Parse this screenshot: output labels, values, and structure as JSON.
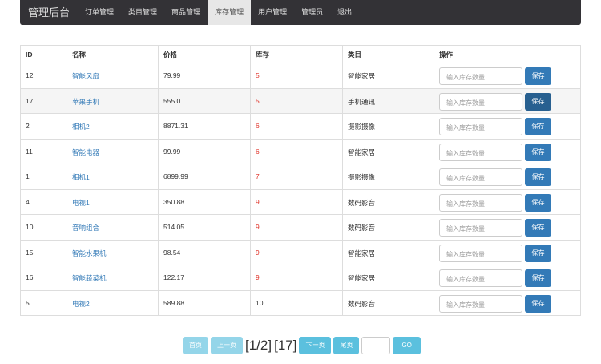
{
  "nav": {
    "brand": "管理后台",
    "items": [
      "订单管理",
      "类目管理",
      "商品管理",
      "库存管理",
      "用户管理",
      "管理员",
      "退出"
    ],
    "active": 3
  },
  "table": {
    "headers": [
      "ID",
      "名称",
      "价格",
      "库存",
      "类目",
      "操作"
    ],
    "rows": [
      [
        "12",
        "智能风扇",
        "79.99",
        "5",
        "智能家居"
      ],
      [
        "17",
        "苹果手机",
        "555.0",
        "5",
        "手机通讯"
      ],
      [
        "2",
        "相机2",
        "8871.31",
        "6",
        "摄影摄像"
      ],
      [
        "11",
        "智能电器",
        "99.99",
        "6",
        "智能家居"
      ],
      [
        "1",
        "相机1",
        "6899.99",
        "7",
        "摄影摄像"
      ],
      [
        "4",
        "电视1",
        "350.88",
        "9",
        "数码影音"
      ],
      [
        "10",
        "音响组合",
        "514.05",
        "9",
        "数码影音"
      ],
      [
        "15",
        "智能水果机",
        "98.54",
        "9",
        "智能家居"
      ],
      [
        "16",
        "智能蔬菜机",
        "122.17",
        "9",
        "智能家居"
      ],
      [
        "5",
        "电视2",
        "589.88",
        "10",
        "数码影音"
      ]
    ],
    "low_stock_flags": [
      true,
      true,
      true,
      true,
      true,
      true,
      true,
      true,
      true,
      false
    ],
    "input_placeholder": "输入库存数量",
    "save_label": "保存"
  },
  "pager": {
    "first": "首页",
    "prev": "上一页",
    "page_info": "[1/2]",
    "total": "[17]",
    "next": "下一页",
    "last": "尾页",
    "go": "GO"
  }
}
